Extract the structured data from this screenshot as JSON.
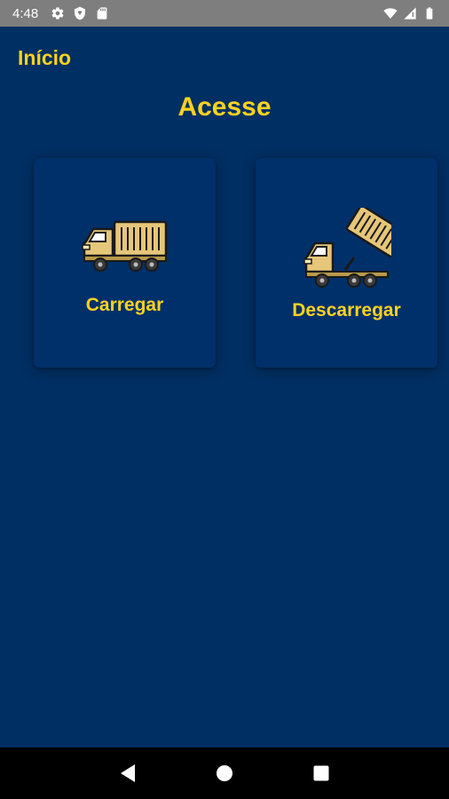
{
  "status_bar": {
    "time": "4:48",
    "icons": [
      "gear-icon",
      "shield-icon",
      "sd-card-icon",
      "wifi-icon",
      "signal-icon",
      "battery-icon"
    ]
  },
  "header": {
    "title": "Início"
  },
  "main": {
    "title": "Acesse",
    "cards": [
      {
        "label": "Carregar",
        "icon": "truck-icon"
      },
      {
        "label": "Descarregar",
        "icon": "dump-truck-icon"
      }
    ]
  },
  "nav_bar": {
    "icons": [
      "back-icon",
      "home-icon",
      "recents-icon"
    ]
  },
  "colors": {
    "background": "#002f63",
    "accent": "#ffd21f",
    "status_bar": "#7e7e7e"
  }
}
